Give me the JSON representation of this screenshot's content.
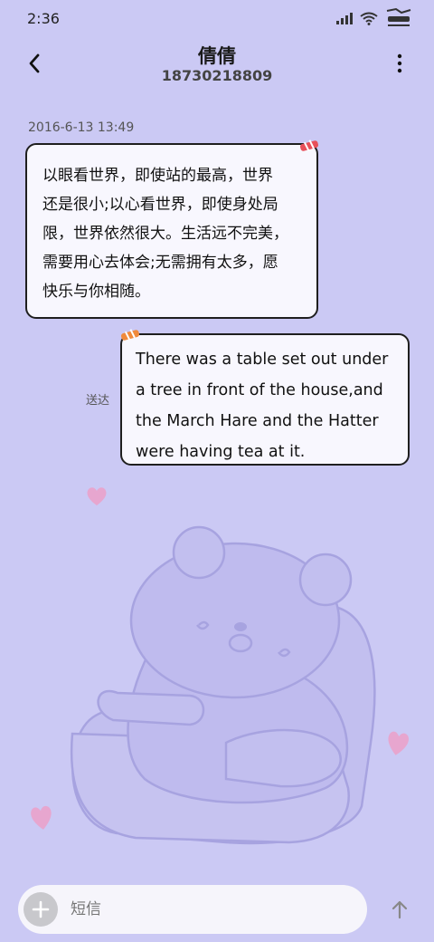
{
  "status_bar": {
    "time": "2:36",
    "icons": [
      "signal-icon",
      "wifi-icon",
      "battery-icon"
    ]
  },
  "header": {
    "contact_name": "倩倩",
    "contact_number": "18730218809"
  },
  "messages": {
    "timestamp": "2016-6-13 13:49",
    "incoming": {
      "lines": [
        "以眼看世界，即使站的最高，世界",
        "还是很小;以心看世界，即使身处局",
        "限，世界依然很大。生活远不完美，",
        "需要用心去体会;无需拥有太多，愿",
        "快乐与你相随。"
      ]
    },
    "outgoing": {
      "lines": [
        "There was a table set out under",
        "a tree in front of the house,and",
        "the March Hare and the Hatter",
        "were having tea at it."
      ],
      "status": "送达"
    }
  },
  "composer": {
    "placeholder": "短信"
  },
  "colors": {
    "background": "#cbc9f4",
    "bubble": "#f8f7fe",
    "bubble_border": "#1f1f1f"
  }
}
